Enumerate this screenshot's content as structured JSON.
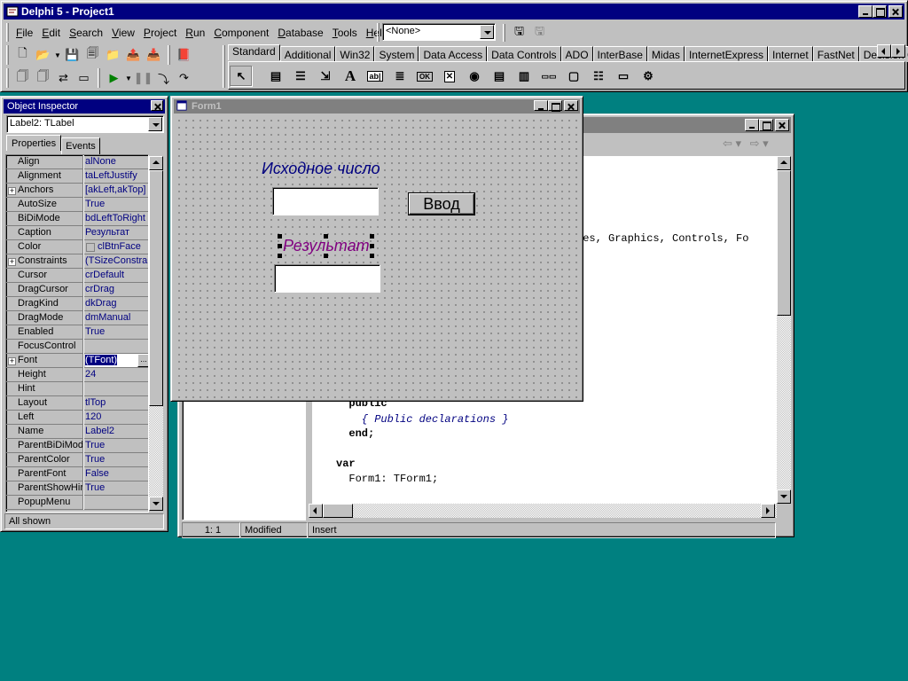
{
  "app": {
    "title": "Delphi 5 - Project1",
    "menu": [
      "File",
      "Edit",
      "Search",
      "View",
      "Project",
      "Run",
      "Component",
      "Database",
      "Tools",
      "Help"
    ],
    "config_combo": "<None>",
    "palette_tabs": [
      "Standard",
      "Additional",
      "Win32",
      "System",
      "Data Access",
      "Data Controls",
      "ADO",
      "InterBase",
      "Midas",
      "InternetExpress",
      "Internet",
      "FastNet",
      "Decision C"
    ],
    "palette_glyph_label": "A",
    "palette_glyph_edit": "ab|",
    "palette_glyph_ok": "OK",
    "palette_glyph_x": "✕",
    "palette_glyph_dot": "◉",
    "palette_glyph_bar": "▭▭"
  },
  "inspector": {
    "title": "Object Inspector",
    "selected_object": "Label2: TLabel",
    "tab_properties": "Properties",
    "tab_events": "Events",
    "status": "All shown",
    "properties": [
      {
        "name": "Align",
        "value": "alNone",
        "expand": false
      },
      {
        "name": "Alignment",
        "value": "taLeftJustify",
        "expand": false
      },
      {
        "name": "Anchors",
        "value": "[akLeft,akTop]",
        "expand": true
      },
      {
        "name": "AutoSize",
        "value": "True",
        "expand": false
      },
      {
        "name": "BiDiMode",
        "value": "bdLeftToRight",
        "expand": false
      },
      {
        "name": "Caption",
        "value": "Результат",
        "expand": false
      },
      {
        "name": "Color",
        "value": "clBtnFace",
        "expand": false
      },
      {
        "name": "Constraints",
        "value": "(TSizeConstrain",
        "expand": true
      },
      {
        "name": "Cursor",
        "value": "crDefault",
        "expand": false
      },
      {
        "name": "DragCursor",
        "value": "crDrag",
        "expand": false
      },
      {
        "name": "DragKind",
        "value": "dkDrag",
        "expand": false
      },
      {
        "name": "DragMode",
        "value": "dmManual",
        "expand": false
      },
      {
        "name": "Enabled",
        "value": "True",
        "expand": false
      },
      {
        "name": "FocusControl",
        "value": "",
        "expand": false
      },
      {
        "name": "Font",
        "value": "(TFont)",
        "expand": true
      },
      {
        "name": "Height",
        "value": "24",
        "expand": false
      },
      {
        "name": "Hint",
        "value": "",
        "expand": false
      },
      {
        "name": "Layout",
        "value": "tlTop",
        "expand": false
      },
      {
        "name": "Left",
        "value": "120",
        "expand": false
      },
      {
        "name": "Name",
        "value": "Label2",
        "expand": false
      },
      {
        "name": "ParentBiDiMod",
        "value": "True",
        "expand": false
      },
      {
        "name": "ParentColor",
        "value": "True",
        "expand": false
      },
      {
        "name": "ParentFont",
        "value": "False",
        "expand": false
      },
      {
        "name": "ParentShowHir",
        "value": "True",
        "expand": false
      },
      {
        "name": "PopupMenu",
        "value": "",
        "expand": false
      }
    ],
    "selected_index": 14,
    "ellipsis": "..."
  },
  "form": {
    "title": "Form1",
    "label1": "Исходное число",
    "label2": "Результат",
    "button": "Ввод",
    "label1_color": "#000080",
    "label2_color": "#800080"
  },
  "editor": {
    "nav_back": "⇦ ▾",
    "nav_fwd": "⇨ ▾",
    "code": [
      {
        "text": "ses, Graphics, Controls, Fo",
        "style": "plain",
        "indent": 0
      },
      {
        "text": "public",
        "style": "kw",
        "indent": 2
      },
      {
        "text": "{ Public declarations }",
        "style": "cmt",
        "indent": 4
      },
      {
        "text": "end;",
        "style": "kw",
        "indent": 2
      },
      {
        "text": "var",
        "style": "kw",
        "indent": 0
      },
      {
        "text": "Form1: TForm1;",
        "style": "plain",
        "indent": 2
      }
    ],
    "status_pos": "1:   1",
    "status_modified": "Modified",
    "status_mode": "Insert"
  }
}
